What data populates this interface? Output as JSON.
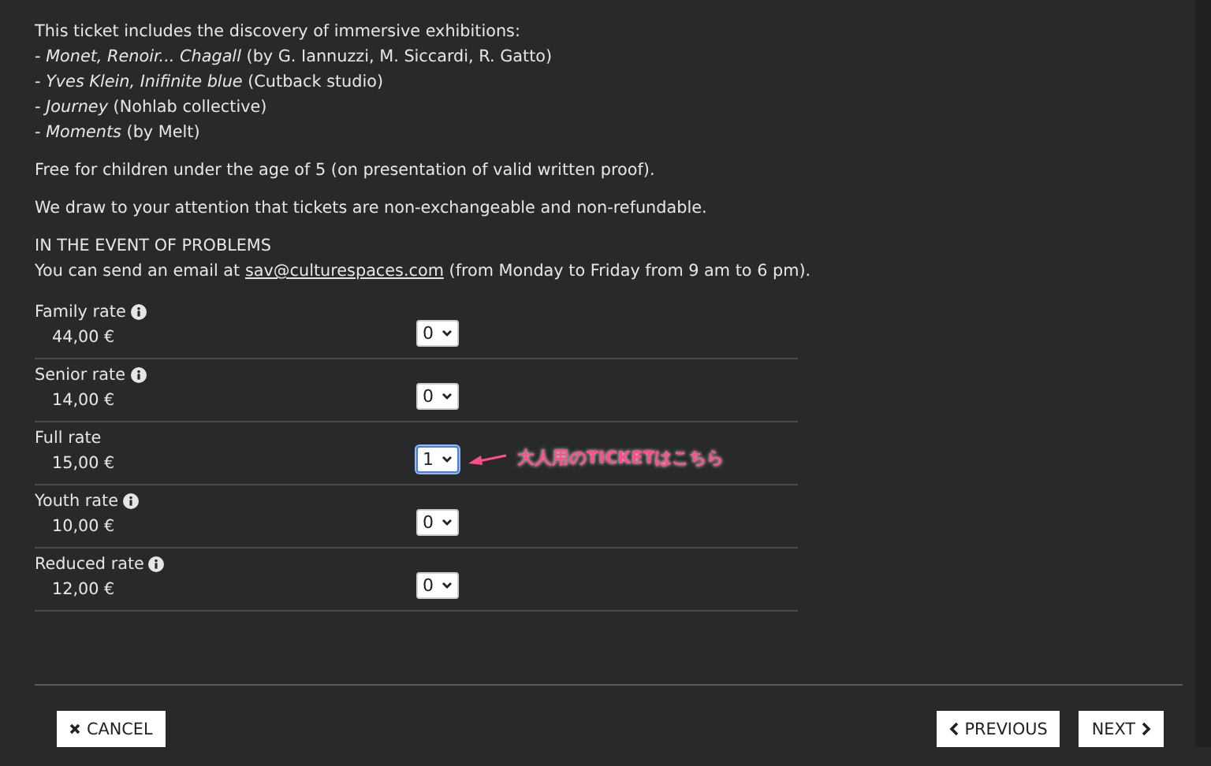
{
  "intro": {
    "lead": "This ticket includes the discovery of immersive exhibitions:",
    "items": [
      "- *Monet, Renoir... Chagall* (by G. Iannuzzi, M. Siccardi, R. Gatto)",
      "- *Yves Klein, Inifinite blue* (Cutback studio)",
      "- *Journey* (Nohlab collective)",
      "- *Moments* (by Melt)"
    ]
  },
  "notes": [
    "Free for children under the age of 5 (on presentation of valid written proof).",
    "We draw to your attention that tickets are non-exchangeable and non-refundable."
  ],
  "problems": {
    "heading": "IN THE EVENT OF PROBLEMS",
    "before": "You can send an email at",
    "email": "sav@culturespaces.com",
    "after": "(from Monday to Friday from 9 am to 6 pm)."
  },
  "rates": [
    {
      "label": "Family rate",
      "info": true,
      "price": "44,00 €",
      "quantity": "0",
      "focused": false
    },
    {
      "label": "Senior rate",
      "info": true,
      "price": "14,00 €",
      "quantity": "0",
      "focused": false
    },
    {
      "label": "Full rate",
      "info": false,
      "price": "15,00 €",
      "quantity": "1",
      "focused": true,
      "annotation": "大人用のTICKETはこちら"
    },
    {
      "label": "Youth rate",
      "info": true,
      "price": "10,00 €",
      "quantity": "0",
      "focused": false
    },
    {
      "label": "Reduced rate",
      "info": true,
      "price": "12,00 €",
      "quantity": "0",
      "focused": false
    }
  ],
  "buttons": {
    "cancel": "CANCEL",
    "previous": "PREVIOUS",
    "next": "NEXT"
  }
}
